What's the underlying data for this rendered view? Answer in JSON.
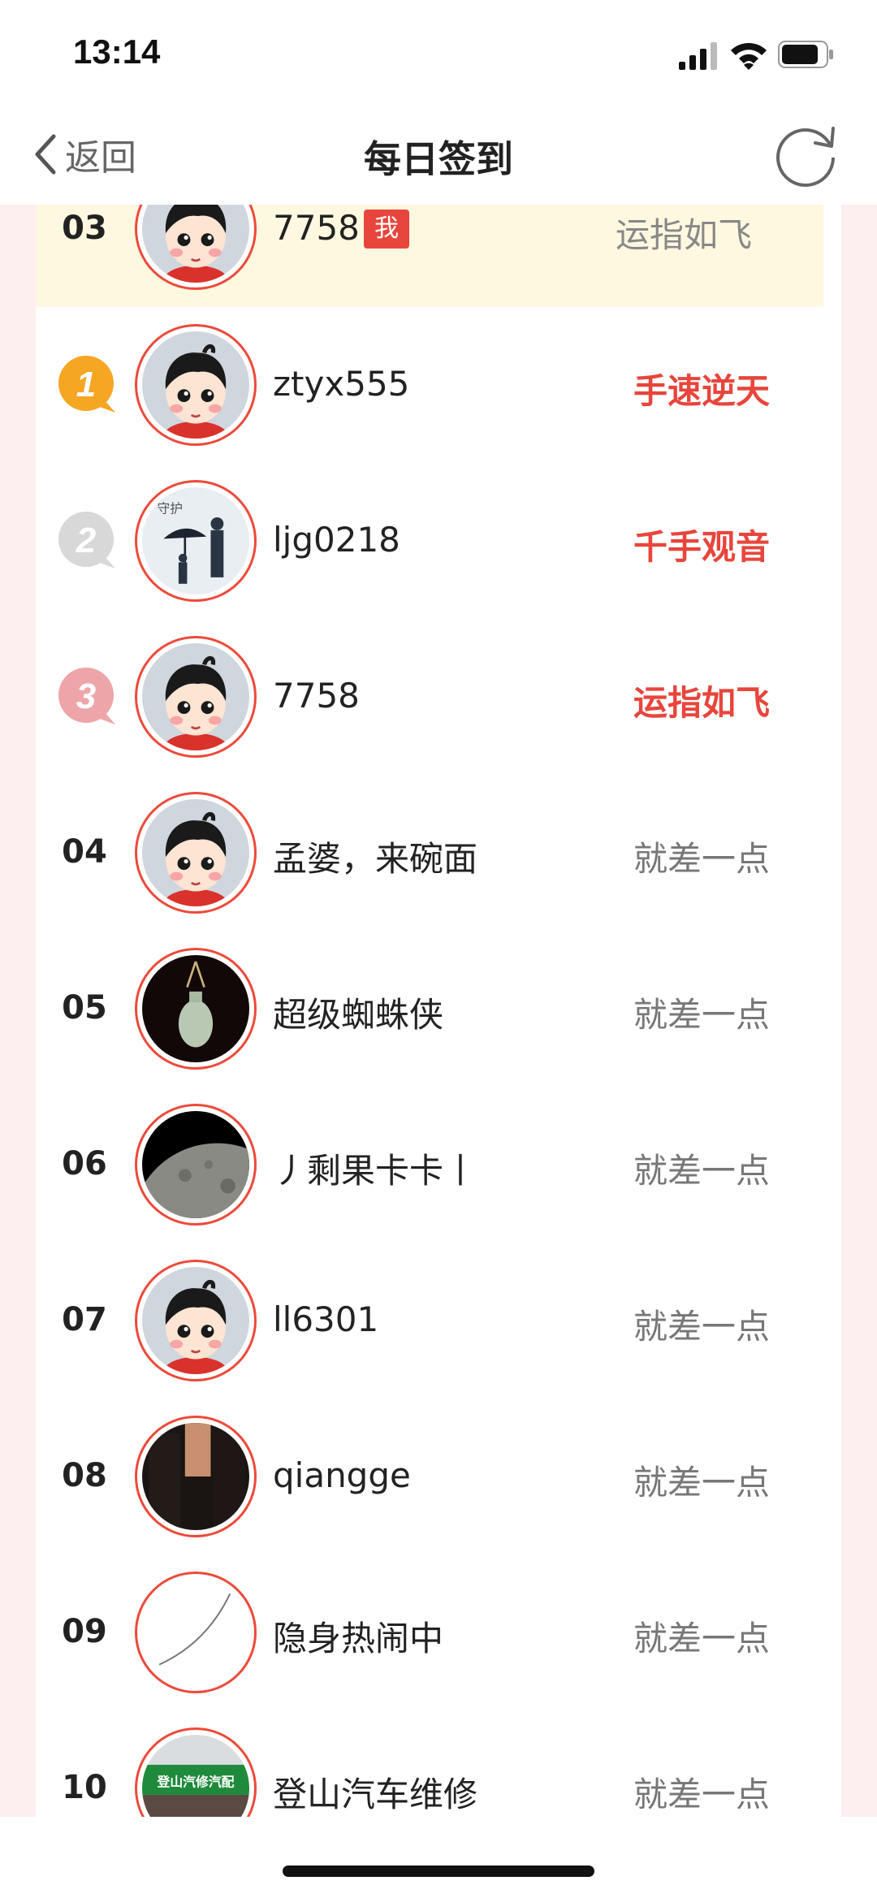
{
  "status_bar": {
    "time": "13:14"
  },
  "nav": {
    "back_label": "返回",
    "title": "每日签到"
  },
  "icons": {
    "back": "chevron-left-icon",
    "refresh": "refresh-icon",
    "signal": "signal-icon",
    "wifi": "wifi-icon",
    "battery": "battery-icon"
  },
  "colors": {
    "accent_red": "#e8453c",
    "page_bg": "#fdeef0",
    "highlight_row": "#fff8e1",
    "gold": "#f5a623"
  },
  "me_row": {
    "rank": "03",
    "username": "7758",
    "badge": "我",
    "title": "运指如飞"
  },
  "rows": [
    {
      "rank": "1",
      "username": "ztyx555",
      "title": "手速逆天"
    },
    {
      "rank": "2",
      "username": "ljg0218",
      "title": "千手观音"
    },
    {
      "rank": "3",
      "username": "7758",
      "title": "运指如飞"
    },
    {
      "rank": "04",
      "username": "孟婆，来碗面",
      "title": "就差一点"
    },
    {
      "rank": "05",
      "username": "超级蜘蛛侠",
      "title": "就差一点"
    },
    {
      "rank": "06",
      "username": "丿剩果卡卡丨",
      "title": "就差一点"
    },
    {
      "rank": "07",
      "username": "ll6301",
      "title": "就差一点"
    },
    {
      "rank": "08",
      "username": "qiangge",
      "title": "就差一点"
    },
    {
      "rank": "09",
      "username": "隐身热闹中",
      "title": "就差一点"
    },
    {
      "rank": "10",
      "username": "登山汽车维修",
      "title": "就差一点"
    }
  ],
  "avatar_sign_text": "登山汽修汽配"
}
